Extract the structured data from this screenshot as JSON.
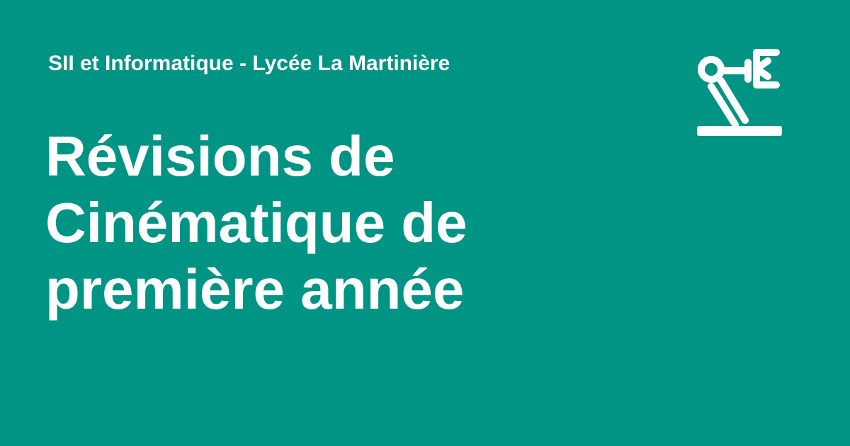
{
  "site": {
    "name": "SII et Informatique - Lycée La Martinière"
  },
  "page": {
    "title": "Révisions de\nCinématique de\npremière année"
  },
  "logo": {
    "icon": "robot-arm-icon",
    "color": "#ffffff"
  },
  "theme": {
    "background": "#009485",
    "text": "#ffffff"
  }
}
